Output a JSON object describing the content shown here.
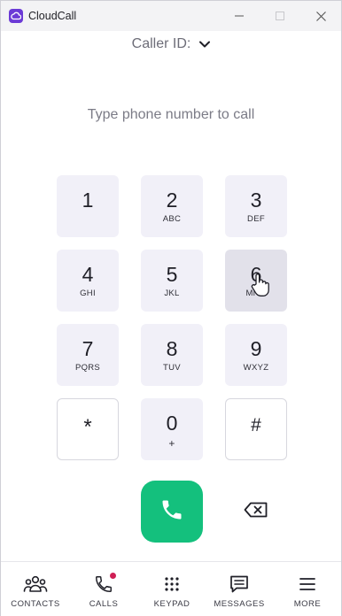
{
  "window": {
    "title": "CloudCall",
    "controls": [
      "minimize",
      "maximize",
      "close"
    ]
  },
  "caller_id": {
    "label": "Caller ID:",
    "dropdown_icon": "chevron-down-icon"
  },
  "number_input": {
    "placeholder": "Type phone number to call",
    "value": ""
  },
  "keypad": {
    "keys": [
      {
        "digit": "1",
        "letters": ""
      },
      {
        "digit": "2",
        "letters": "ABC"
      },
      {
        "digit": "3",
        "letters": "DEF"
      },
      {
        "digit": "4",
        "letters": "GHI"
      },
      {
        "digit": "5",
        "letters": "JKL"
      },
      {
        "digit": "6",
        "letters": "MNO"
      },
      {
        "digit": "7",
        "letters": "PQRS"
      },
      {
        "digit": "8",
        "letters": "TUV"
      },
      {
        "digit": "9",
        "letters": "WXYZ"
      },
      {
        "digit": "*",
        "letters": ""
      },
      {
        "digit": "0",
        "letters": "+"
      },
      {
        "digit": "#",
        "letters": ""
      }
    ],
    "hovered_key": "6"
  },
  "actions": {
    "call_icon": "phone-icon",
    "backspace_icon": "backspace-icon"
  },
  "nav": {
    "items": [
      {
        "label": "CONTACTS",
        "icon": "contacts-icon"
      },
      {
        "label": "CALLS",
        "icon": "phone-outline-icon",
        "badge": true
      },
      {
        "label": "KEYPAD",
        "icon": "keypad-icon",
        "active": true
      },
      {
        "label": "MESSAGES",
        "icon": "messages-icon"
      },
      {
        "label": "MORE",
        "icon": "menu-icon"
      }
    ]
  },
  "colors": {
    "brand": "#6b3ad6",
    "call_green": "#14c07d",
    "key_bg": "#f1f0f8",
    "badge": "#cf1f55"
  }
}
